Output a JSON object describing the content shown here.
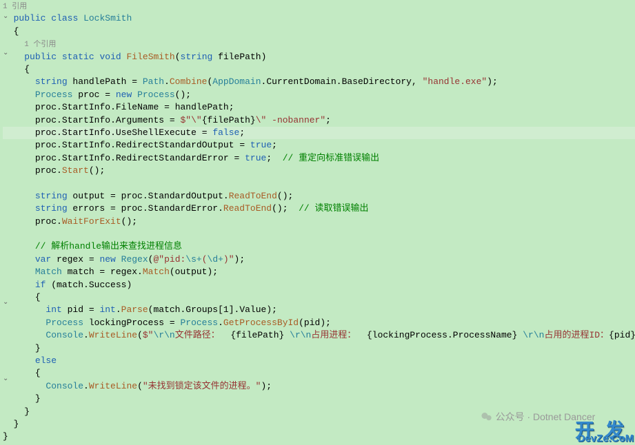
{
  "refs": {
    "top": "1 引用",
    "inner": "1 个引用"
  },
  "code": {
    "l1": {
      "kw": "public",
      "kw2": "class",
      "name": "LockSmith"
    },
    "l2": "{",
    "l4": {
      "kw": "public",
      "kw2": "static",
      "kw3": "void",
      "name": "FileSmith",
      "sig_open": "(",
      "ptype": "string",
      "pname": " filePath",
      "sig_close": ")"
    },
    "l5": "{",
    "l6": {
      "t1": "string",
      "v1": " handlePath = ",
      "t2": "Path",
      "d1": ".",
      "m1": "Combine",
      "p1": "(",
      "t3": "AppDomain",
      "d2": ".",
      "p2": "CurrentDomain",
      "d3": ".",
      "p3": "BaseDirectory",
      "c1": ", ",
      "s1": "\"handle.exe\"",
      "p4": ");"
    },
    "l7": {
      "t1": "Process",
      "v1": " proc = ",
      "kw": "new",
      "sp": " ",
      "t2": "Process",
      "p1": "();"
    },
    "l8": {
      "v1": "proc",
      "d1": ".",
      "p1": "StartInfo",
      "d2": ".",
      "p2": "FileName",
      "eq": " = handlePath;"
    },
    "l9": {
      "v1": "proc",
      "d1": ".",
      "p1": "StartInfo",
      "d2": ".",
      "p2": "Arguments",
      "eq": " = ",
      "interp": "$\"\\\"",
      "ib": "{filePath}",
      "s2": "\\\" -nobanner\"",
      "end": ";"
    },
    "l10": {
      "v1": "proc",
      "d1": ".",
      "p1": "StartInfo",
      "d2": ".",
      "p2": "UseShellExecute",
      "eq": " = ",
      "kw": "false",
      "end": ";"
    },
    "l11": {
      "v1": "proc",
      "d1": ".",
      "p1": "StartInfo",
      "d2": ".",
      "p2": "RedirectStandardOutput",
      "eq": " = ",
      "kw": "true",
      "end": ";"
    },
    "l12": {
      "v1": "proc",
      "d1": ".",
      "p1": "StartInfo",
      "d2": ".",
      "p2": "RedirectStandardError",
      "eq": " = ",
      "kw": "true",
      "end": ";  ",
      "cm": "// 重定向标准错误输出"
    },
    "l13": {
      "v1": "proc",
      "d1": ".",
      "m1": "Start",
      "p1": "();"
    },
    "l15": {
      "t1": "string",
      "v1": " output = proc",
      "d1": ".",
      "p1": "StandardOutput",
      "d2": ".",
      "m1": "ReadToEnd",
      "p2": "();"
    },
    "l16": {
      "t1": "string",
      "v1": " errors = proc",
      "d1": ".",
      "p1": "StandardError",
      "d2": ".",
      "m1": "ReadToEnd",
      "p2": "();  ",
      "cm": "// 读取错误输出"
    },
    "l17": {
      "v1": "proc",
      "d1": ".",
      "m1": "WaitForExit",
      "p1": "();"
    },
    "l19": {
      "cm": "// 解析handle输出来查找进程信息"
    },
    "l20": {
      "kw": "var",
      "v1": " regex = ",
      "kw2": "new",
      "sp": " ",
      "t1": "Regex",
      "p1": "(",
      "at": "@\"pid:",
      "re": "\\s+",
      "p2": "(",
      "re2": "\\d+",
      "p3": ")",
      "qe": "\"",
      "p4": ");"
    },
    "l21": {
      "t1": "Match",
      "v1": " match = regex",
      "d1": ".",
      "m1": "Match",
      "p1": "(output);"
    },
    "l22": {
      "kw": "if",
      "p1": " (match",
      "d1": ".",
      "p2": "Success",
      "p3": ")"
    },
    "l23": "{",
    "l24": {
      "t1": "int",
      "v1": " pid = ",
      "t2": "int",
      "d1": ".",
      "m1": "Parse",
      "p1": "(match",
      "d2": ".",
      "p2": "Groups",
      "br": "[1]",
      "d3": ".",
      "p3": "Value",
      "p4": ");"
    },
    "l25": {
      "t1": "Process",
      "v1": " lockingProcess = ",
      "t2": "Process",
      "d1": ".",
      "m1": "GetProcessById",
      "p1": "(pid);"
    },
    "l26": {
      "t1": "Console",
      "d1": ".",
      "m1": "WriteLine",
      "p1": "(",
      "s0": "$\"",
      "e1": "\\r\\n",
      "s1": "文件路径：  ",
      "i1": "{filePath}",
      "sp1": " ",
      "e2": "\\r\\n",
      "s2": "占用进程：  ",
      "i2": "{lockingProcess.ProcessName}",
      "sp2": " ",
      "e3": "\\r\\n",
      "s3": "占用的进程ID：",
      "i3": "{pid}",
      "sp3": " ",
      "qe": "\"",
      "p2": ");"
    },
    "l27": "}",
    "l28": {
      "kw": "else"
    },
    "l29": "{",
    "l30": {
      "t1": "Console",
      "d1": ".",
      "m1": "WriteLine",
      "p1": "(",
      "s1": "\"未找到锁定该文件的进程。\"",
      "p2": ");"
    },
    "l31": "}",
    "l32": "}",
    "l33": "}",
    "l34": "}"
  },
  "watermark": "公众号 · Dotnet Dancer",
  "logo": {
    "main": "开 发 者",
    "sub": "DevZe.CoM"
  }
}
